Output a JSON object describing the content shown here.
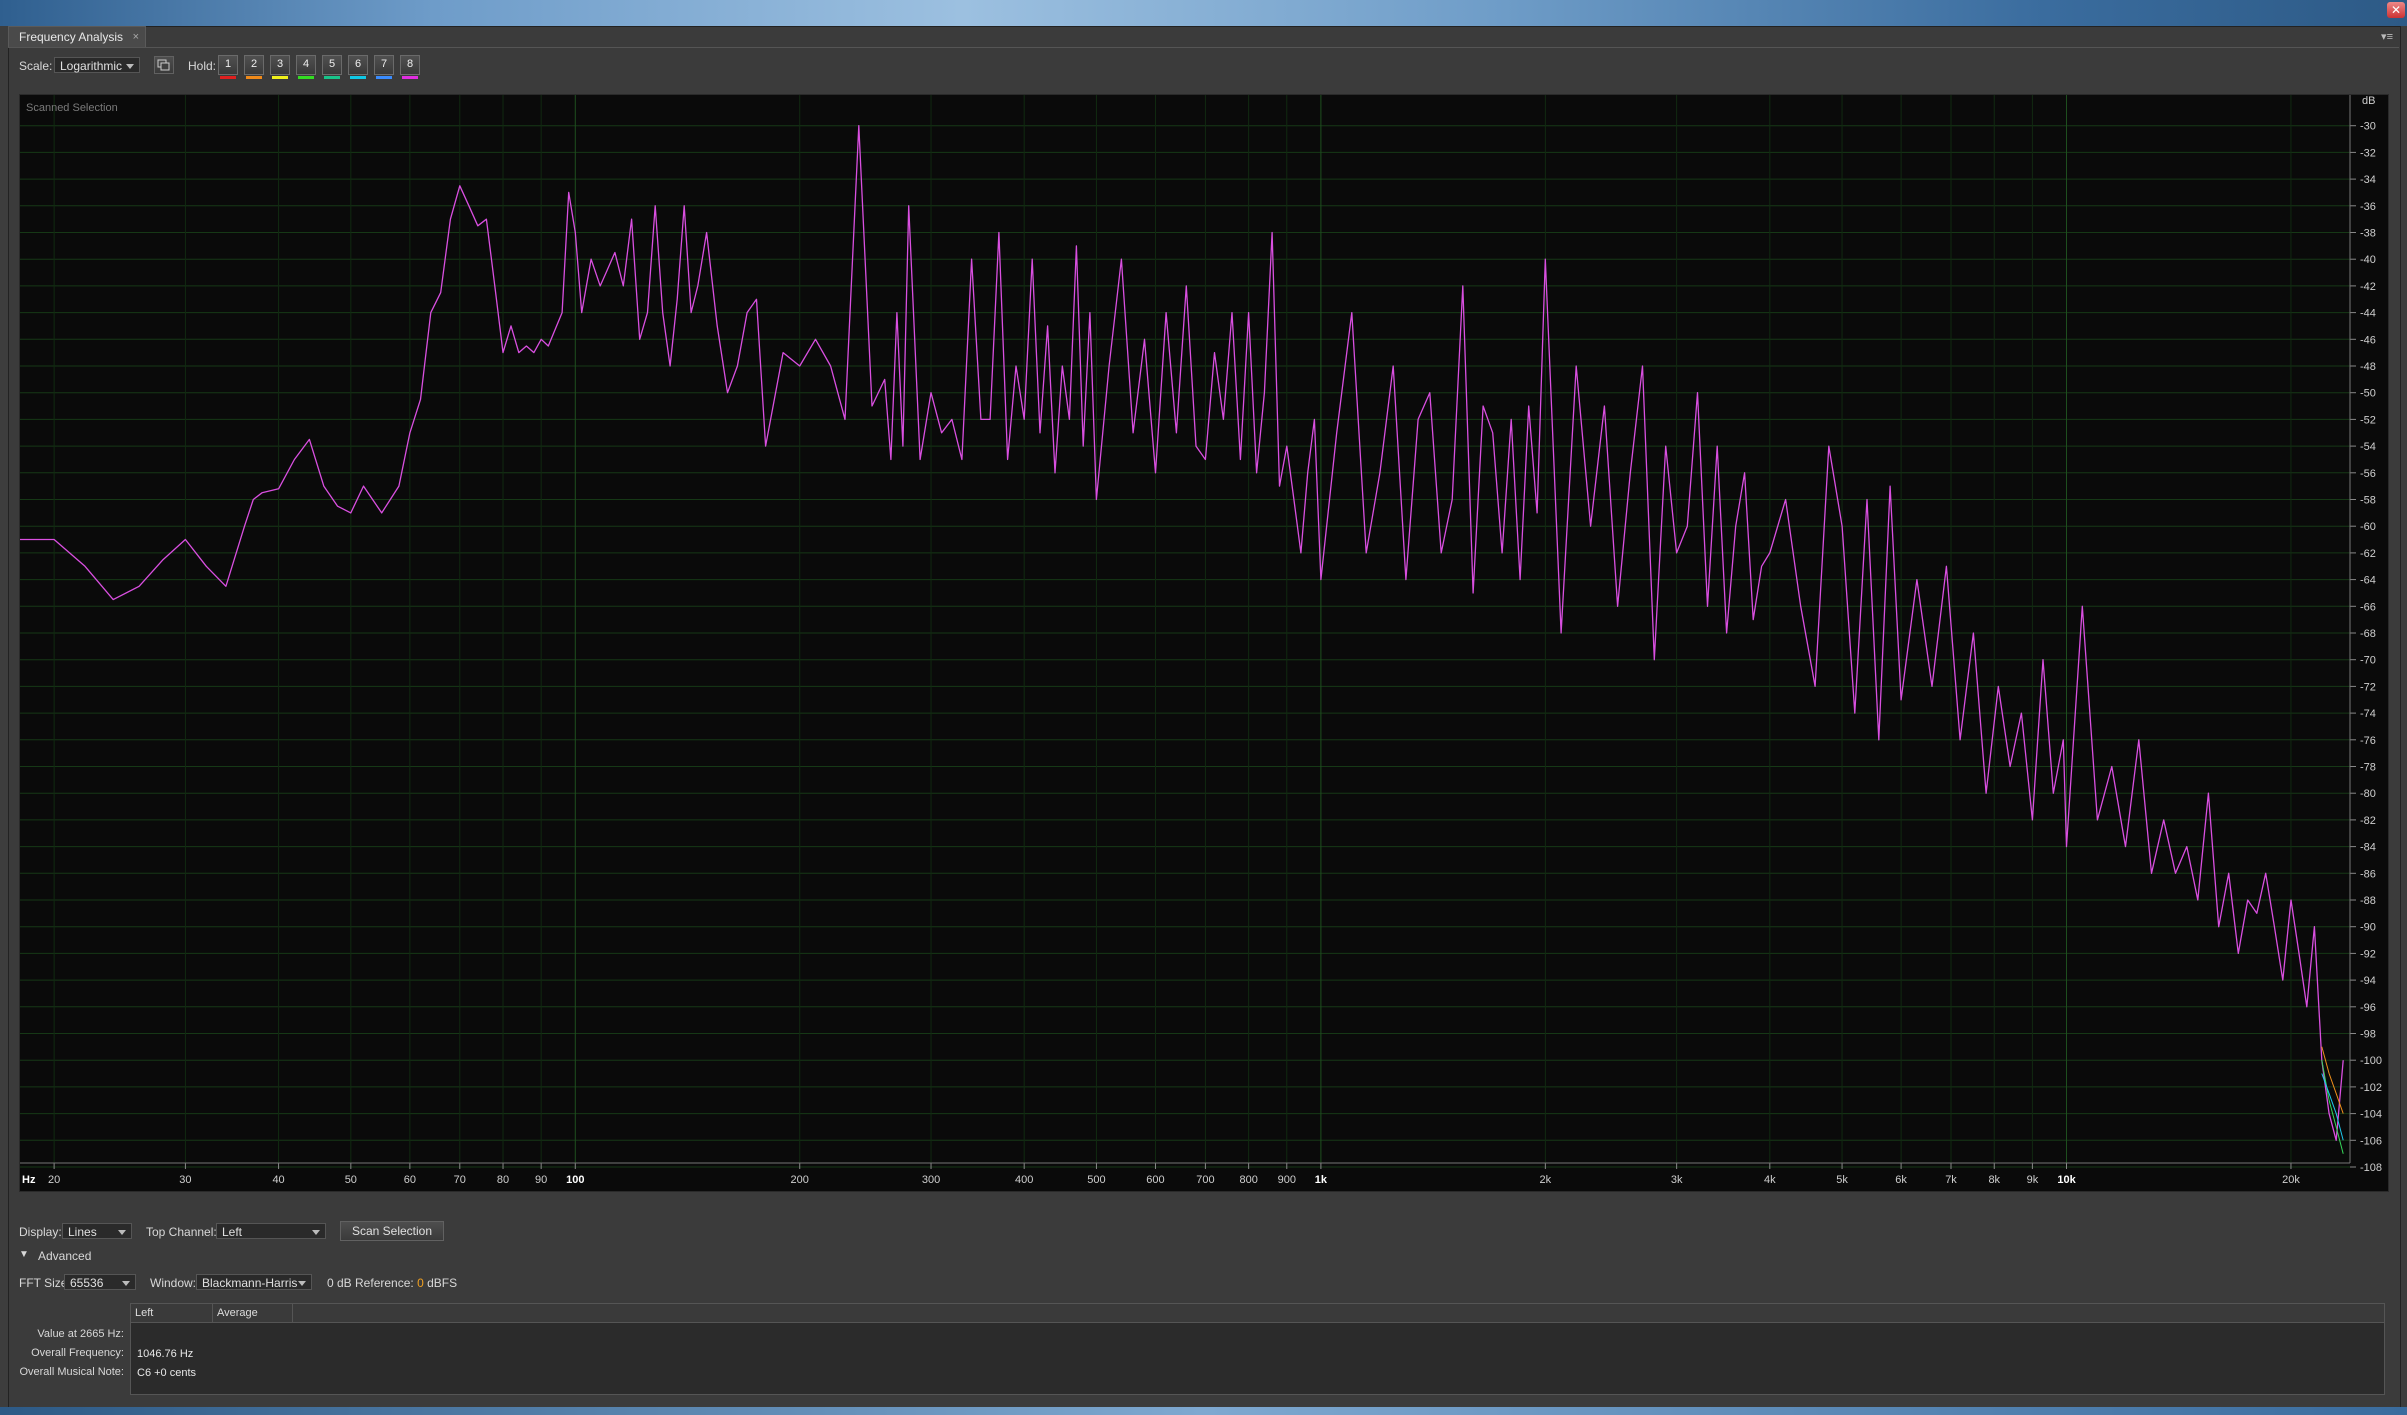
{
  "tab": {
    "title": "Frequency Analysis",
    "close": "×",
    "menu": "▾≡"
  },
  "toolbar": {
    "scale_label": "Scale:",
    "scale_value": "Logarithmic",
    "hold_label": "Hold:",
    "hold_buttons": [
      "1",
      "2",
      "3",
      "4",
      "5",
      "6",
      "7",
      "8"
    ],
    "hold_colors": [
      "#e0201f",
      "#f08a1a",
      "#f2f21c",
      "#33dd22",
      "#18c48a",
      "#10c8e6",
      "#3a8cff",
      "#e02ee0"
    ]
  },
  "chart_data": {
    "type": "line",
    "title": "Scanned Selection",
    "x_scale": "log",
    "xlim": [
      18,
      24000
    ],
    "ylim": [
      -108,
      -28
    ],
    "x_unit": "Hz",
    "y_unit": "dB",
    "x_ticks": [
      {
        "v": 20,
        "label": "20"
      },
      {
        "v": 30,
        "label": "30"
      },
      {
        "v": 40,
        "label": "40"
      },
      {
        "v": 50,
        "label": "50"
      },
      {
        "v": 60,
        "label": "60"
      },
      {
        "v": 70,
        "label": "70"
      },
      {
        "v": 80,
        "label": "80"
      },
      {
        "v": 90,
        "label": "90"
      },
      {
        "v": 100,
        "label": "100",
        "major": true
      },
      {
        "v": 200,
        "label": "200"
      },
      {
        "v": 300,
        "label": "300"
      },
      {
        "v": 400,
        "label": "400"
      },
      {
        "v": 500,
        "label": "500"
      },
      {
        "v": 600,
        "label": "600"
      },
      {
        "v": 700,
        "label": "700"
      },
      {
        "v": 800,
        "label": "800"
      },
      {
        "v": 900,
        "label": "900"
      },
      {
        "v": 1000,
        "label": "1k",
        "major": true
      },
      {
        "v": 2000,
        "label": "2k"
      },
      {
        "v": 3000,
        "label": "3k"
      },
      {
        "v": 4000,
        "label": "4k"
      },
      {
        "v": 5000,
        "label": "5k"
      },
      {
        "v": 6000,
        "label": "6k"
      },
      {
        "v": 7000,
        "label": "7k"
      },
      {
        "v": 8000,
        "label": "8k"
      },
      {
        "v": 9000,
        "label": "9k"
      },
      {
        "v": 10000,
        "label": "10k",
        "major": true
      },
      {
        "v": 20000,
        "label": "20k"
      }
    ],
    "y_ticks": [
      -30,
      -32,
      -34,
      -36,
      -38,
      -40,
      -42,
      -44,
      -46,
      -48,
      -50,
      -52,
      -54,
      -56,
      -58,
      -60,
      -62,
      -64,
      -66,
      -68,
      -70,
      -72,
      -74,
      -76,
      -78,
      -80,
      -82,
      -84,
      -86,
      -88,
      -90,
      -92,
      -94,
      -96,
      -98,
      -100,
      -102,
      -104,
      -106,
      -108
    ],
    "grid": true,
    "series": [
      {
        "color": "#d94fe0",
        "x": [
          18,
          20,
          22,
          24,
          26,
          28,
          30,
          32,
          34,
          36,
          37,
          38,
          40,
          42,
          44,
          46,
          48,
          50,
          52,
          55,
          58,
          60,
          62,
          64,
          66,
          68,
          70,
          72,
          74,
          76,
          78,
          80,
          82,
          84,
          86,
          88,
          90,
          92,
          96,
          98,
          100,
          102,
          105,
          108,
          110,
          113,
          116,
          119,
          122,
          125,
          128,
          131,
          134,
          137,
          140,
          143,
          146,
          150,
          155,
          160,
          165,
          170,
          175,
          180,
          190,
          200,
          210,
          220,
          230,
          240,
          250,
          260,
          265,
          270,
          275,
          280,
          290,
          300,
          310,
          320,
          330,
          340,
          350,
          360,
          370,
          380,
          390,
          400,
          410,
          420,
          430,
          440,
          450,
          460,
          470,
          480,
          490,
          500,
          520,
          540,
          560,
          580,
          600,
          620,
          640,
          660,
          680,
          700,
          720,
          740,
          760,
          780,
          800,
          820,
          840,
          860,
          880,
          900,
          920,
          940,
          960,
          980,
          1000,
          1050,
          1100,
          1150,
          1200,
          1250,
          1300,
          1350,
          1400,
          1450,
          1500,
          1550,
          1600,
          1650,
          1700,
          1750,
          1800,
          1850,
          1900,
          1950,
          2000,
          2100,
          2200,
          2300,
          2400,
          2500,
          2600,
          2700,
          2800,
          2900,
          3000,
          3100,
          3200,
          3300,
          3400,
          3500,
          3600,
          3700,
          3800,
          3900,
          4000,
          4200,
          4400,
          4600,
          4800,
          5000,
          5200,
          5400,
          5600,
          5800,
          6000,
          6300,
          6600,
          6900,
          7200,
          7500,
          7800,
          8100,
          8400,
          8700,
          9000,
          9300,
          9600,
          9900,
          10000,
          10500,
          11000,
          11500,
          12000,
          12500,
          13000,
          13500,
          14000,
          14500,
          15000,
          15500,
          16000,
          16500,
          17000,
          17500,
          18000,
          18500,
          19000,
          19500,
          20000,
          20500,
          21000,
          21500,
          22000,
          22500,
          23000,
          23500
        ],
        "y": [
          -61,
          -61,
          -63,
          -65.5,
          -64.5,
          -62.5,
          -61,
          -63,
          -64.5,
          -60,
          -58,
          -57.5,
          -57.2,
          -55,
          -53.5,
          -57,
          -58.5,
          -59,
          -57,
          -59,
          -57,
          -53,
          -50.5,
          -44,
          -42.5,
          -37,
          -34.5,
          -36,
          -37.5,
          -37,
          -42,
          -47,
          -45,
          -47,
          -46.5,
          -47,
          -46,
          -46.5,
          -44,
          -35,
          -38,
          -44,
          -40,
          -42,
          -41,
          -39.5,
          -42,
          -37,
          -46,
          -44,
          -36,
          -44,
          -48,
          -43,
          -36,
          -44,
          -42,
          -38,
          -45,
          -50,
          -48,
          -44,
          -43,
          -54,
          -47,
          -48,
          -46,
          -48,
          -52,
          -30,
          -51,
          -49,
          -55,
          -44,
          -54,
          -36,
          -55,
          -50,
          -53,
          -52,
          -55,
          -40,
          -52,
          -52,
          -38,
          -55,
          -48,
          -52,
          -40,
          -53,
          -45,
          -56,
          -48,
          -52,
          -39,
          -54,
          -44,
          -58,
          -48,
          -40,
          -53,
          -46,
          -56,
          -44,
          -53,
          -42,
          -54,
          -55,
          -47,
          -52,
          -44,
          -55,
          -44,
          -56,
          -50,
          -38,
          -57,
          -54,
          -58,
          -62,
          -56,
          -52,
          -64,
          -53,
          -44,
          -62,
          -56,
          -48,
          -64,
          -52,
          -50,
          -62,
          -58,
          -42,
          -65,
          -51,
          -53,
          -62,
          -52,
          -64,
          -51,
          -59,
          -40,
          -68,
          -48,
          -60,
          -51,
          -66,
          -56,
          -48,
          -70,
          -54,
          -62,
          -60,
          -50,
          -66,
          -54,
          -68,
          -60,
          -56,
          -67,
          -63,
          -62,
          -58,
          -66,
          -72,
          -54,
          -60,
          -74,
          -58,
          -76,
          -57,
          -73,
          -64,
          -72,
          -63,
          -76,
          -68,
          -80,
          -72,
          -78,
          -74,
          -82,
          -70,
          -80,
          -76,
          -84,
          -66,
          -82,
          -78,
          -84,
          -76,
          -86,
          -82,
          -86,
          -84,
          -88,
          -80,
          -90,
          -86,
          -92,
          -88,
          -89,
          -86,
          -90,
          -94,
          -88,
          -92,
          -96,
          -90,
          -100,
          -104,
          -106,
          -100
        ]
      },
      {
        "color": "#36d95a",
        "x": [
          22000,
          22500,
          23000,
          23500
        ],
        "y": [
          -100,
          -103,
          -105,
          -107
        ]
      },
      {
        "color": "#1ec8ee",
        "x": [
          22000,
          22500,
          23000,
          23500
        ],
        "y": [
          -101,
          -102.5,
          -104,
          -106
        ]
      },
      {
        "color": "#f0901c",
        "x": [
          22000,
          22500,
          23000,
          23500
        ],
        "y": [
          -99,
          -101,
          -102.5,
          -104
        ]
      }
    ]
  },
  "controls": {
    "display_label": "Display:",
    "display_value": "Lines",
    "top_channel_label": "Top Channel:",
    "top_channel_value": "Left",
    "scan_button": "Scan Selection",
    "advanced_label": "Advanced",
    "fft_label": "FFT Size:",
    "fft_value": "65536",
    "window_label": "Window:",
    "window_value": "Blackmann-Harris",
    "ref_label": "0 dB Reference:",
    "ref_value": "0",
    "ref_unit": "dBFS"
  },
  "table": {
    "columns": [
      "Left",
      "Average"
    ],
    "rows": [
      {
        "label": "Value at 2665 Hz:",
        "value": ""
      },
      {
        "label": "Overall Frequency:",
        "value": "1046.76 Hz"
      },
      {
        "label": "Overall Musical Note:",
        "value": "C6 +0 cents"
      }
    ]
  }
}
